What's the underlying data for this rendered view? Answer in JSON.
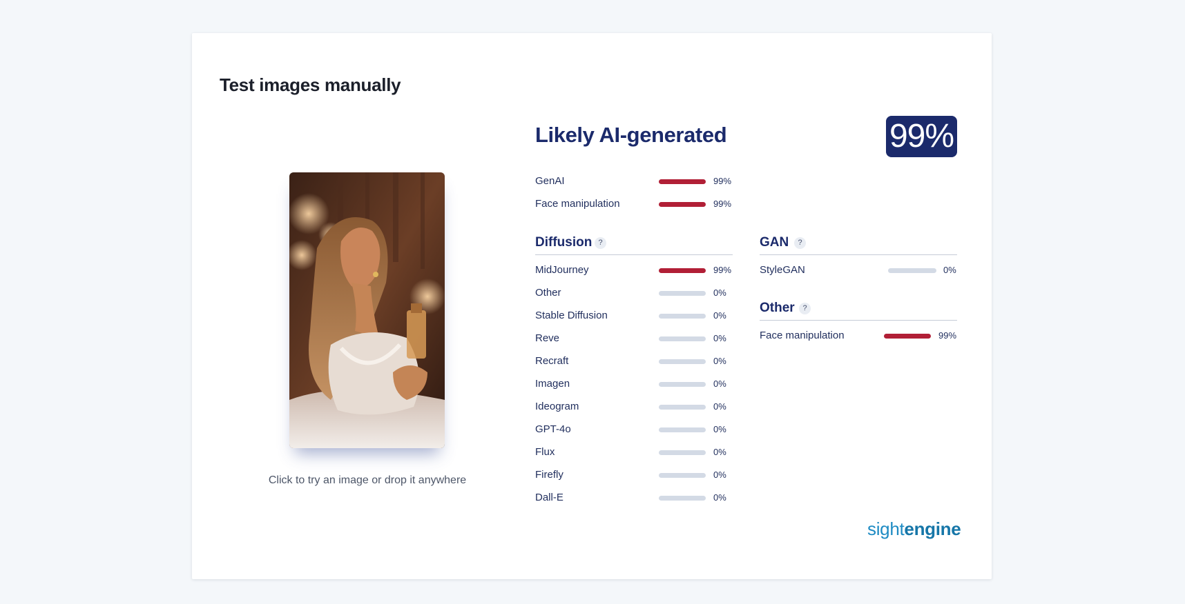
{
  "page_title": "Test images manually",
  "drop_hint": "Click to try an image or drop it anywhere",
  "verdict": "Likely AI-generated",
  "score": "99%",
  "summary": [
    {
      "label": "GenAI",
      "value": "99%",
      "level": 0.99
    },
    {
      "label": "Face manipulation",
      "value": "99%",
      "level": 0.99
    }
  ],
  "diffusion": {
    "title": "Diffusion",
    "help": "?",
    "items": [
      {
        "label": "MidJourney",
        "value": "99%",
        "level": 0.99
      },
      {
        "label": "Other",
        "value": "0%",
        "level": 0
      },
      {
        "label": "Stable Diffusion",
        "value": "0%",
        "level": 0
      },
      {
        "label": "Reve",
        "value": "0%",
        "level": 0
      },
      {
        "label": "Recraft",
        "value": "0%",
        "level": 0
      },
      {
        "label": "Imagen",
        "value": "0%",
        "level": 0
      },
      {
        "label": "Ideogram",
        "value": "0%",
        "level": 0
      },
      {
        "label": "GPT-4o",
        "value": "0%",
        "level": 0
      },
      {
        "label": "Flux",
        "value": "0%",
        "level": 0
      },
      {
        "label": "Firefly",
        "value": "0%",
        "level": 0
      },
      {
        "label": "Dall-E",
        "value": "0%",
        "level": 0
      }
    ]
  },
  "gan": {
    "title": "GAN",
    "help": "?",
    "items": [
      {
        "label": "StyleGAN",
        "value": "0%",
        "level": 0
      }
    ]
  },
  "other": {
    "title": "Other",
    "help": "?",
    "items": [
      {
        "label": "Face manipulation",
        "value": "99%",
        "level": 0.99
      }
    ]
  },
  "brand": {
    "part1": "sight",
    "part2": "engine"
  },
  "colors": {
    "accent": "#1b2a6b",
    "high": "#b11f36",
    "low": "#d3dae5",
    "brand": "#1e8bc3"
  }
}
